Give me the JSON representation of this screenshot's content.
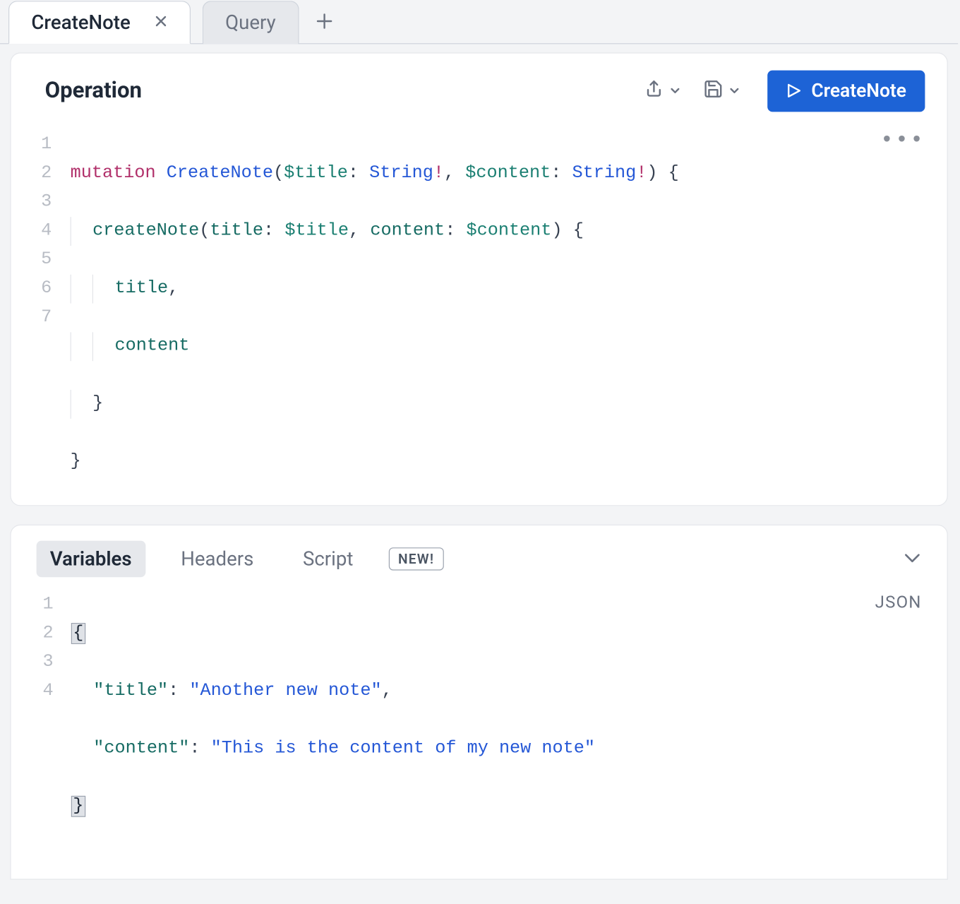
{
  "tabs": [
    {
      "label": "CreateNote",
      "active": true,
      "closable": true
    },
    {
      "label": "Query",
      "active": false,
      "closable": false
    }
  ],
  "operation": {
    "title": "Operation",
    "run_label": "CreateNote",
    "line_numbers": [
      "1",
      "2",
      "3",
      "4",
      "5",
      "6",
      "7"
    ],
    "code": {
      "l1": {
        "kw": "mutation",
        "name": "CreateNote",
        "v1": "$title",
        "t1": "String",
        "v2": "$content",
        "t2": "String"
      },
      "l2": {
        "fn": "createNote",
        "a1k": "title",
        "a1v": "$title",
        "a2k": "content",
        "a2v": "$content"
      },
      "l3": "title",
      "l4": "content"
    }
  },
  "bottom": {
    "tabs": {
      "variables": "Variables",
      "headers": "Headers",
      "script": "Script",
      "new_badge": "NEW!"
    },
    "format_label": "JSON",
    "line_numbers": [
      "1",
      "2",
      "3",
      "4"
    ],
    "vars": {
      "k1": "\"title\"",
      "v1": "\"Another new note\"",
      "k2": "\"content\"",
      "v2": "\"This is the content of my new note\""
    }
  }
}
